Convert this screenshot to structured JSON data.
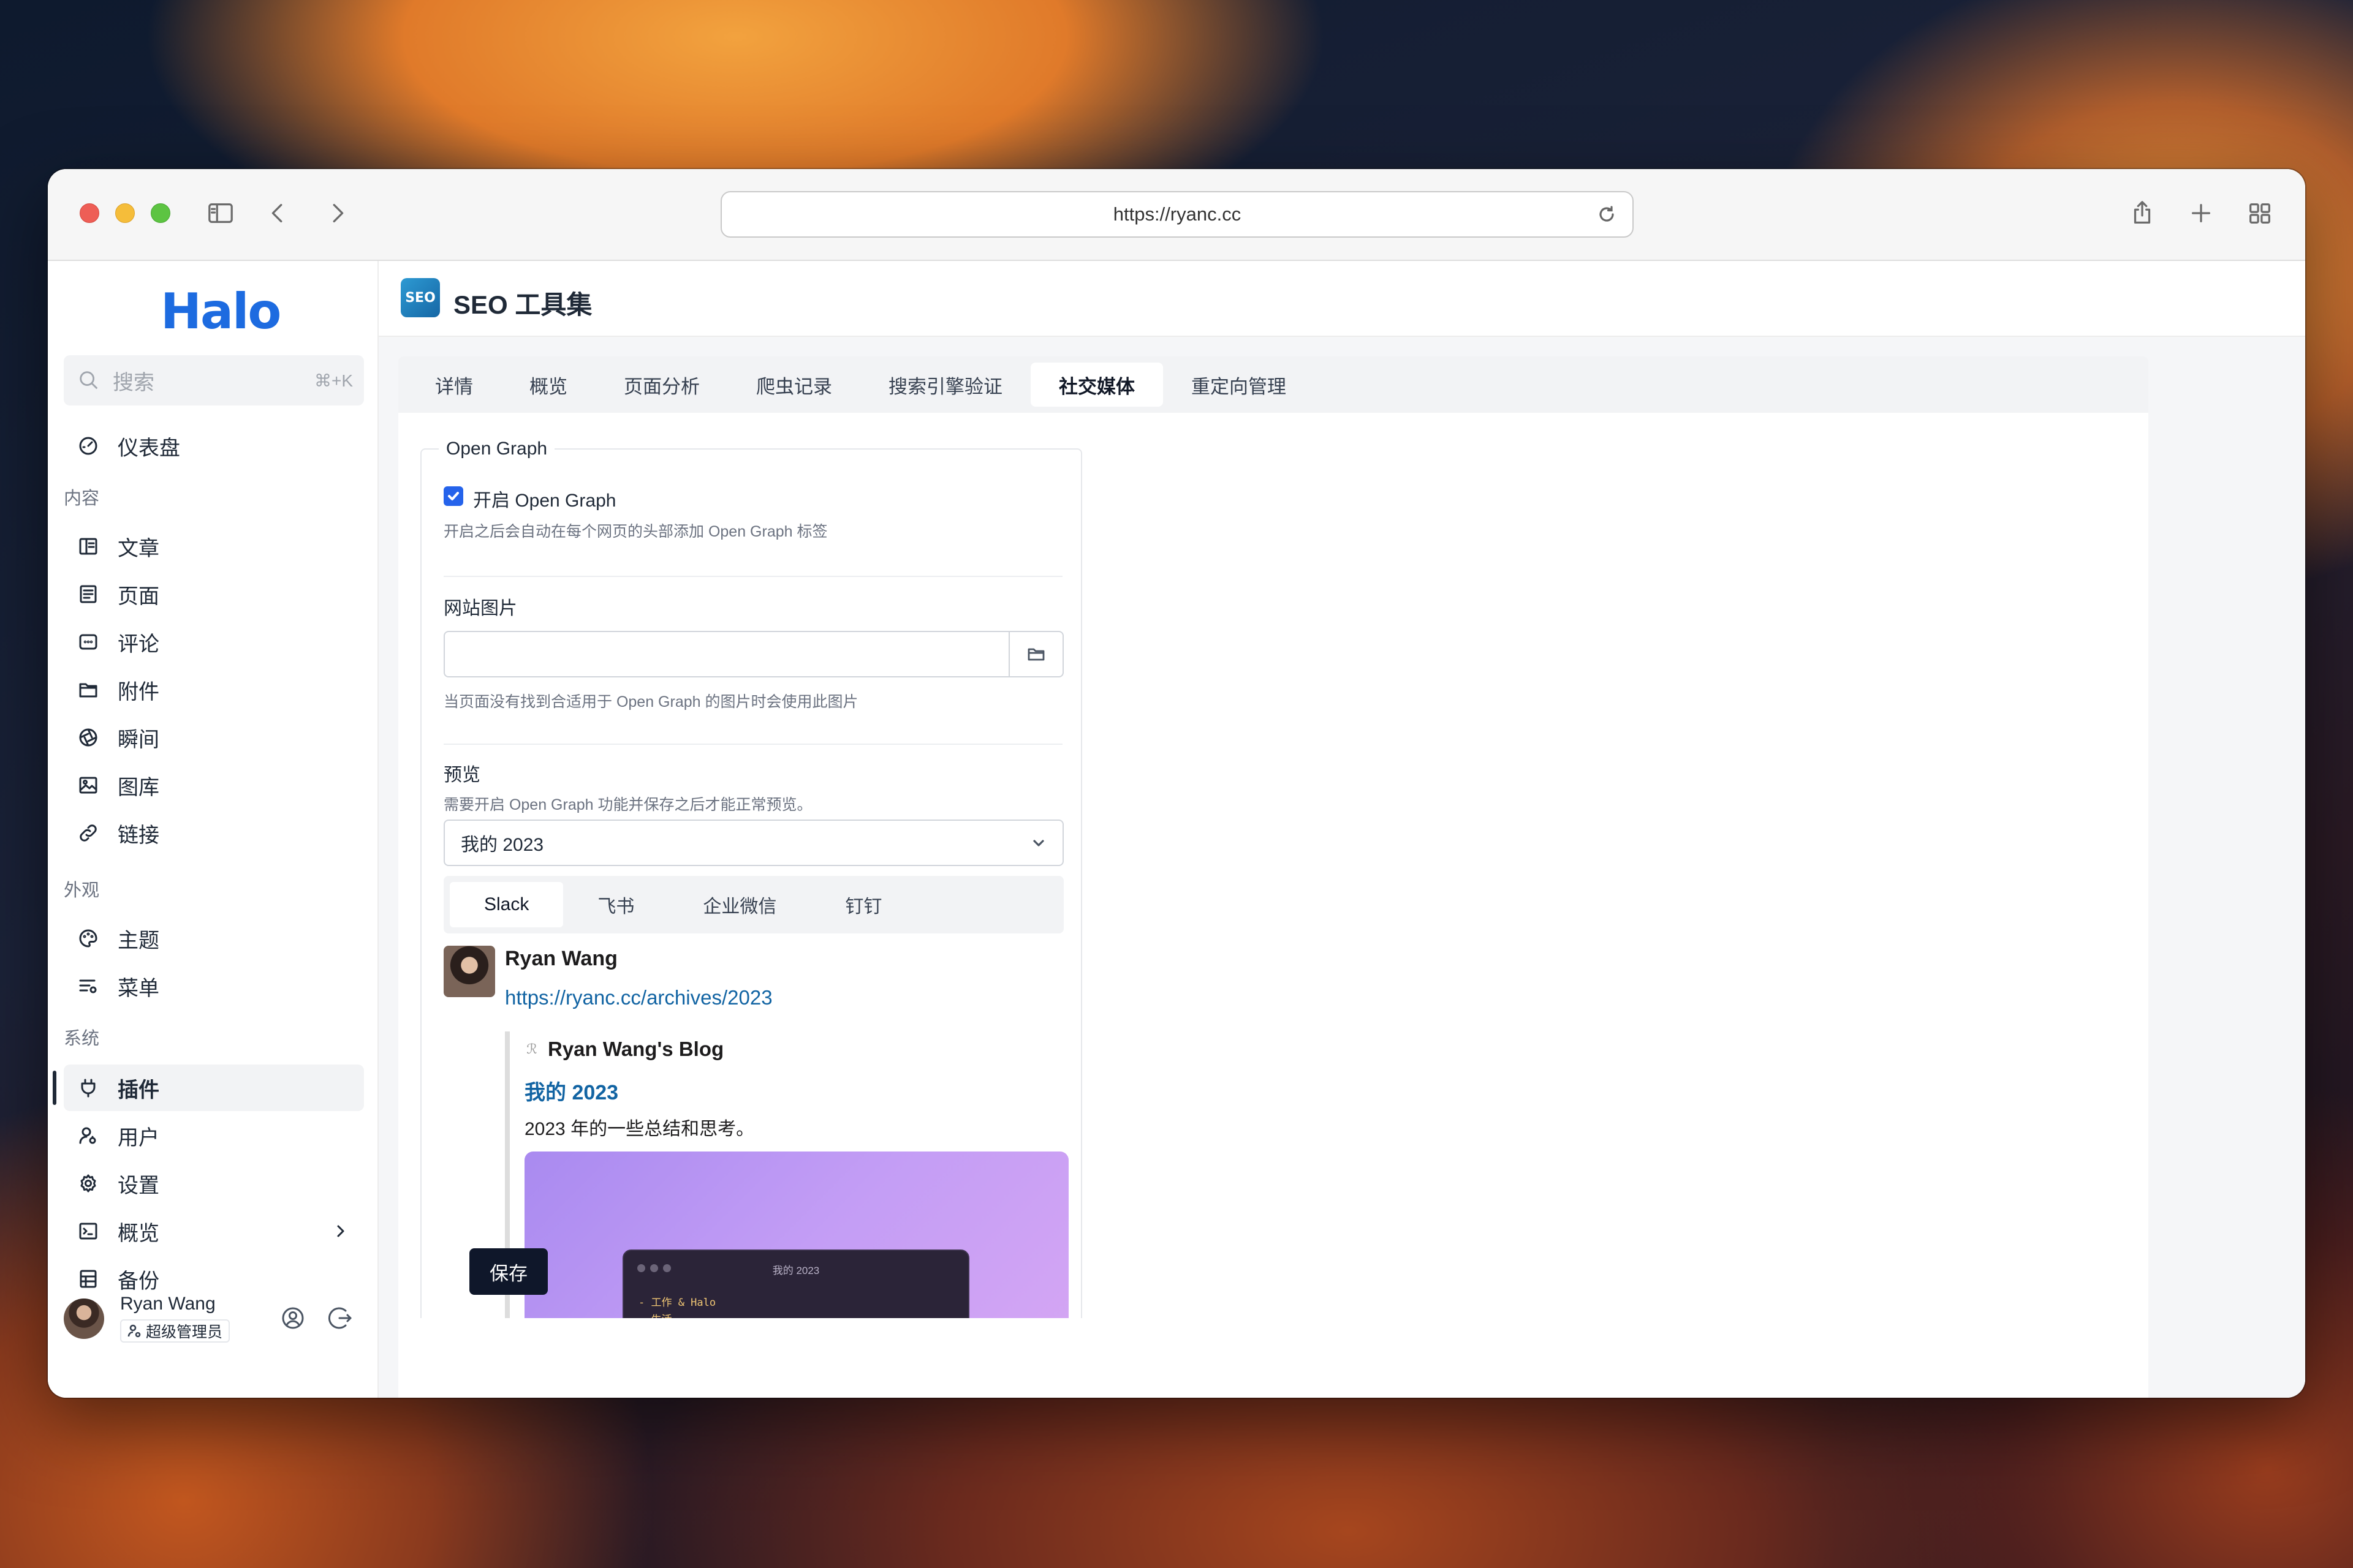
{
  "browser": {
    "url": "https://ryanc.cc"
  },
  "sidebar": {
    "logo": "Halo",
    "search_placeholder": "搜索",
    "search_shortcut": "⌘+K",
    "dashboard": "仪表盘",
    "groups": {
      "content": "内容",
      "appearance": "外观",
      "system": "系统"
    },
    "content_items": [
      "文章",
      "页面",
      "评论",
      "附件",
      "瞬间",
      "图库",
      "链接"
    ],
    "appearance_items": [
      "主题",
      "菜单"
    ],
    "system_items": [
      "插件",
      "用户",
      "设置",
      "概览",
      "备份"
    ],
    "active_item": "插件",
    "user": {
      "name": "Ryan Wang",
      "role": "超级管理员"
    }
  },
  "header": {
    "badge": "SEO",
    "title": "SEO 工具集"
  },
  "tabs": [
    "详情",
    "概览",
    "页面分析",
    "爬虫记录",
    "搜索引擎验证",
    "社交媒体",
    "重定向管理"
  ],
  "active_tab": "社交媒体",
  "form": {
    "legend": "Open Graph",
    "enable_label": "开启 Open Graph",
    "enable_checked": true,
    "enable_help": "开启之后会自动在每个网页的头部添加 Open Graph 标签",
    "site_image_label": "网站图片",
    "site_image_value": "",
    "site_image_help": "当页面没有找到合适用于 Open Graph 的图片时会使用此图片",
    "preview_label": "预览",
    "preview_help": "需要开启 Open Graph 功能并保存之后才能正常预览。",
    "preview_select": "我的 2023",
    "preview_tabs": [
      "Slack",
      "飞书",
      "企业微信",
      "钉钉"
    ],
    "preview_active_tab": "Slack"
  },
  "slack_preview": {
    "user_name": "Ryan Wang",
    "link": "https://ryanc.cc/archives/2023",
    "site_name": "Ryan Wang's Blog",
    "title": "我的 2023",
    "description": "2023 年的一些总结和思考。",
    "image": {
      "window_title": "我的 2023",
      "lines": [
        "- 工作 & Halo",
        "- 生活"
      ]
    }
  },
  "save_label": "保存"
}
